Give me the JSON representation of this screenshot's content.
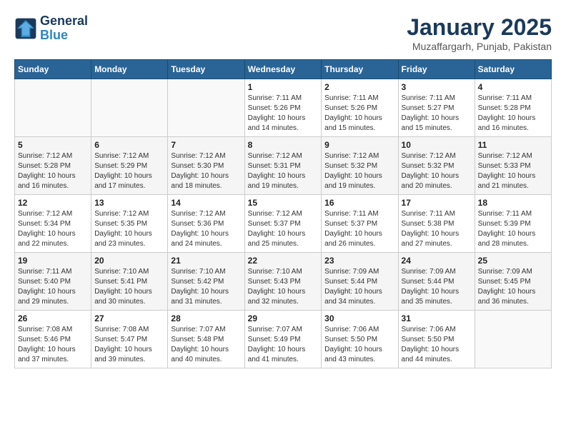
{
  "header": {
    "logo_line1": "General",
    "logo_line2": "Blue",
    "title": "January 2025",
    "subtitle": "Muzaffargarh, Punjab, Pakistan"
  },
  "weekdays": [
    "Sunday",
    "Monday",
    "Tuesday",
    "Wednesday",
    "Thursday",
    "Friday",
    "Saturday"
  ],
  "weeks": [
    [
      {
        "day": "",
        "info": ""
      },
      {
        "day": "",
        "info": ""
      },
      {
        "day": "",
        "info": ""
      },
      {
        "day": "1",
        "info": "Sunrise: 7:11 AM\nSunset: 5:26 PM\nDaylight: 10 hours\nand 14 minutes."
      },
      {
        "day": "2",
        "info": "Sunrise: 7:11 AM\nSunset: 5:26 PM\nDaylight: 10 hours\nand 15 minutes."
      },
      {
        "day": "3",
        "info": "Sunrise: 7:11 AM\nSunset: 5:27 PM\nDaylight: 10 hours\nand 15 minutes."
      },
      {
        "day": "4",
        "info": "Sunrise: 7:11 AM\nSunset: 5:28 PM\nDaylight: 10 hours\nand 16 minutes."
      }
    ],
    [
      {
        "day": "5",
        "info": "Sunrise: 7:12 AM\nSunset: 5:28 PM\nDaylight: 10 hours\nand 16 minutes."
      },
      {
        "day": "6",
        "info": "Sunrise: 7:12 AM\nSunset: 5:29 PM\nDaylight: 10 hours\nand 17 minutes."
      },
      {
        "day": "7",
        "info": "Sunrise: 7:12 AM\nSunset: 5:30 PM\nDaylight: 10 hours\nand 18 minutes."
      },
      {
        "day": "8",
        "info": "Sunrise: 7:12 AM\nSunset: 5:31 PM\nDaylight: 10 hours\nand 19 minutes."
      },
      {
        "day": "9",
        "info": "Sunrise: 7:12 AM\nSunset: 5:32 PM\nDaylight: 10 hours\nand 19 minutes."
      },
      {
        "day": "10",
        "info": "Sunrise: 7:12 AM\nSunset: 5:32 PM\nDaylight: 10 hours\nand 20 minutes."
      },
      {
        "day": "11",
        "info": "Sunrise: 7:12 AM\nSunset: 5:33 PM\nDaylight: 10 hours\nand 21 minutes."
      }
    ],
    [
      {
        "day": "12",
        "info": "Sunrise: 7:12 AM\nSunset: 5:34 PM\nDaylight: 10 hours\nand 22 minutes."
      },
      {
        "day": "13",
        "info": "Sunrise: 7:12 AM\nSunset: 5:35 PM\nDaylight: 10 hours\nand 23 minutes."
      },
      {
        "day": "14",
        "info": "Sunrise: 7:12 AM\nSunset: 5:36 PM\nDaylight: 10 hours\nand 24 minutes."
      },
      {
        "day": "15",
        "info": "Sunrise: 7:12 AM\nSunset: 5:37 PM\nDaylight: 10 hours\nand 25 minutes."
      },
      {
        "day": "16",
        "info": "Sunrise: 7:11 AM\nSunset: 5:37 PM\nDaylight: 10 hours\nand 26 minutes."
      },
      {
        "day": "17",
        "info": "Sunrise: 7:11 AM\nSunset: 5:38 PM\nDaylight: 10 hours\nand 27 minutes."
      },
      {
        "day": "18",
        "info": "Sunrise: 7:11 AM\nSunset: 5:39 PM\nDaylight: 10 hours\nand 28 minutes."
      }
    ],
    [
      {
        "day": "19",
        "info": "Sunrise: 7:11 AM\nSunset: 5:40 PM\nDaylight: 10 hours\nand 29 minutes."
      },
      {
        "day": "20",
        "info": "Sunrise: 7:10 AM\nSunset: 5:41 PM\nDaylight: 10 hours\nand 30 minutes."
      },
      {
        "day": "21",
        "info": "Sunrise: 7:10 AM\nSunset: 5:42 PM\nDaylight: 10 hours\nand 31 minutes."
      },
      {
        "day": "22",
        "info": "Sunrise: 7:10 AM\nSunset: 5:43 PM\nDaylight: 10 hours\nand 32 minutes."
      },
      {
        "day": "23",
        "info": "Sunrise: 7:09 AM\nSunset: 5:44 PM\nDaylight: 10 hours\nand 34 minutes."
      },
      {
        "day": "24",
        "info": "Sunrise: 7:09 AM\nSunset: 5:44 PM\nDaylight: 10 hours\nand 35 minutes."
      },
      {
        "day": "25",
        "info": "Sunrise: 7:09 AM\nSunset: 5:45 PM\nDaylight: 10 hours\nand 36 minutes."
      }
    ],
    [
      {
        "day": "26",
        "info": "Sunrise: 7:08 AM\nSunset: 5:46 PM\nDaylight: 10 hours\nand 37 minutes."
      },
      {
        "day": "27",
        "info": "Sunrise: 7:08 AM\nSunset: 5:47 PM\nDaylight: 10 hours\nand 39 minutes."
      },
      {
        "day": "28",
        "info": "Sunrise: 7:07 AM\nSunset: 5:48 PM\nDaylight: 10 hours\nand 40 minutes."
      },
      {
        "day": "29",
        "info": "Sunrise: 7:07 AM\nSunset: 5:49 PM\nDaylight: 10 hours\nand 41 minutes."
      },
      {
        "day": "30",
        "info": "Sunrise: 7:06 AM\nSunset: 5:50 PM\nDaylight: 10 hours\nand 43 minutes."
      },
      {
        "day": "31",
        "info": "Sunrise: 7:06 AM\nSunset: 5:50 PM\nDaylight: 10 hours\nand 44 minutes."
      },
      {
        "day": "",
        "info": ""
      }
    ]
  ]
}
